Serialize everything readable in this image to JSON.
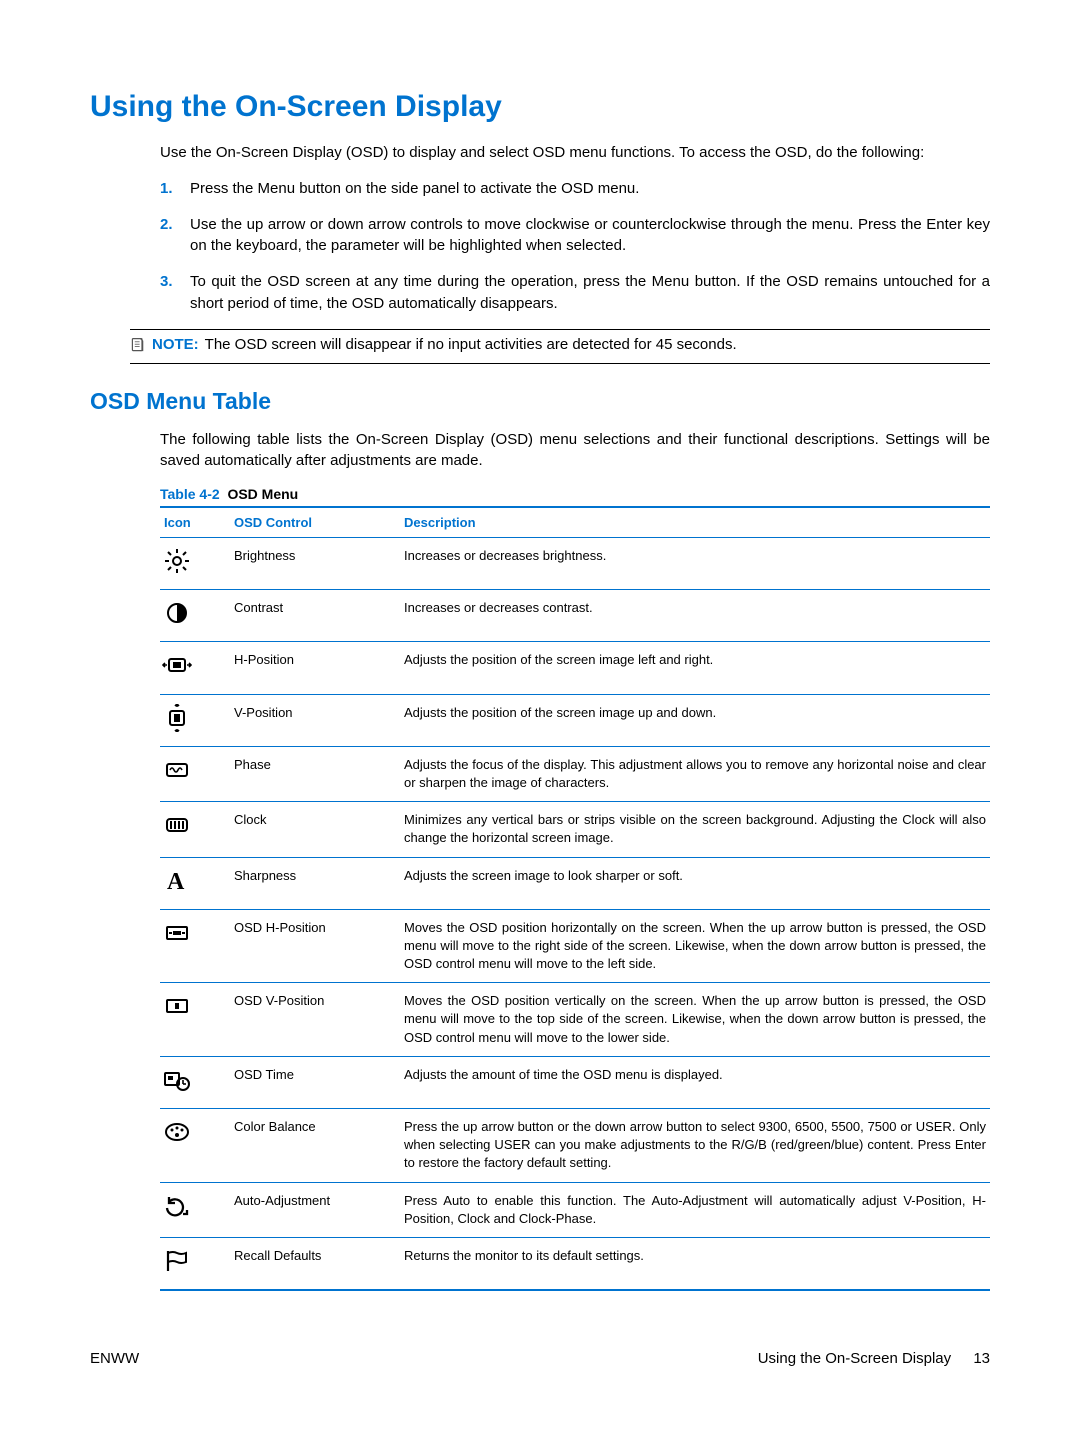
{
  "heading1": "Using the On-Screen Display",
  "intro": "Use the On-Screen Display (OSD) to display and select OSD menu functions. To access the OSD, do the following:",
  "steps": [
    "Press the Menu button on the side panel to activate the OSD menu.",
    "Use the up arrow or down arrow controls to move clockwise or counterclockwise through the menu. Press the Enter key on the keyboard, the parameter will be highlighted when selected.",
    "To quit the OSD screen at any time during the operation, press the Menu button. If the OSD remains untouched for a short period of time, the OSD automatically disappears."
  ],
  "note_label": "NOTE:",
  "note_text": "The OSD screen will disappear if no input activities are detected for 45 seconds.",
  "heading2": "OSD Menu Table",
  "table_intro": "The following table lists the On-Screen Display (OSD) menu selections and their functional descriptions. Settings will be saved automatically after adjustments are made.",
  "table_caption_prefix": "Table 4-2",
  "table_caption_name": "OSD Menu",
  "table_headers": {
    "icon": "Icon",
    "control": "OSD Control",
    "description": "Description"
  },
  "rows": [
    {
      "icon": "brightness-icon",
      "control": "Brightness",
      "desc": "Increases or decreases brightness."
    },
    {
      "icon": "contrast-icon",
      "control": "Contrast",
      "desc": "Increases or decreases contrast."
    },
    {
      "icon": "h-position-icon",
      "control": "H-Position",
      "desc": "Adjusts the position of the screen image left and right."
    },
    {
      "icon": "v-position-icon",
      "control": "V-Position",
      "desc": "Adjusts the position of the screen image up and down."
    },
    {
      "icon": "phase-icon",
      "control": "Phase",
      "desc": "Adjusts the focus of the display. This adjustment allows you to remove any horizontal noise and clear or sharpen the image of characters."
    },
    {
      "icon": "clock-icon",
      "control": "Clock",
      "desc": "Minimizes any vertical bars or strips visible on the screen background. Adjusting the Clock will also change the horizontal screen image."
    },
    {
      "icon": "sharpness-icon",
      "control": "Sharpness",
      "desc": "Adjusts the screen image to look sharper or soft."
    },
    {
      "icon": "osd-h-position-icon",
      "control": "OSD H-Position",
      "desc": "Moves the OSD position horizontally on the screen. When the up arrow button is pressed, the OSD menu will move to the right side of the screen. Likewise, when the down arrow button is pressed, the OSD control menu will move to the left side."
    },
    {
      "icon": "osd-v-position-icon",
      "control": "OSD V-Position",
      "desc": "Moves the OSD position vertically on the screen. When the up arrow button is pressed, the OSD menu will move to the top side of the screen. Likewise, when the down arrow button is pressed, the OSD control menu will move to the lower side."
    },
    {
      "icon": "osd-time-icon",
      "control": "OSD Time",
      "desc": "Adjusts the amount of time the OSD menu is displayed."
    },
    {
      "icon": "color-balance-icon",
      "control": "Color Balance",
      "desc": "Press the up arrow button or the down arrow button to select 9300, 6500, 5500, 7500 or USER. Only when selecting USER can you make adjustments to the R/G/B (red/green/blue) content. Press Enter to restore the factory default setting."
    },
    {
      "icon": "auto-adjustment-icon",
      "control": "Auto-Adjustment",
      "desc": "Press Auto to enable this function. The Auto-Adjustment will automatically adjust V-Position, H-Position, Clock and Clock-Phase."
    },
    {
      "icon": "recall-defaults-icon",
      "control": "Recall Defaults",
      "desc": "Returns the monitor to its default settings."
    }
  ],
  "footer_left": "ENWW",
  "footer_right_text": "Using the On-Screen Display",
  "footer_page": "13"
}
